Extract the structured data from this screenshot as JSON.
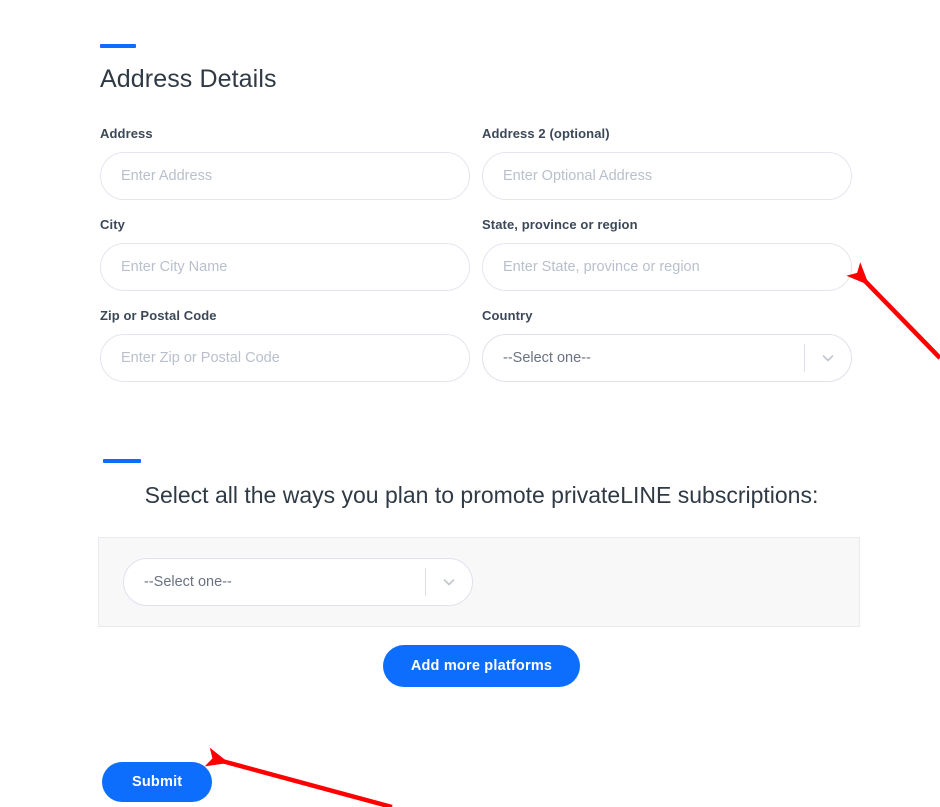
{
  "theme": {
    "accent": "#0d6efd",
    "label_color": "#3c4858",
    "heading_color": "#2f3a45",
    "placeholder_color": "#b9bfcc",
    "panel_bg": "#f8f8f9",
    "annotation_color": "#ff0000"
  },
  "address_section": {
    "title": "Address Details",
    "fields": [
      {
        "label": "Address",
        "placeholder": "Enter Address",
        "value": "",
        "type": "text"
      },
      {
        "label": "Address 2 (optional)",
        "placeholder": "Enter Optional Address",
        "value": "",
        "type": "text"
      },
      {
        "label": "City",
        "placeholder": "Enter City Name",
        "value": "",
        "type": "text"
      },
      {
        "label": "State, province or region",
        "placeholder": "Enter State, province or region",
        "value": "",
        "type": "text"
      },
      {
        "label": "Zip or Postal Code",
        "placeholder": "Enter Zip or Postal Code",
        "value": "",
        "type": "text"
      },
      {
        "label": "Country",
        "placeholder": "",
        "value": "--Select one--",
        "type": "select"
      }
    ]
  },
  "promote_section": {
    "title": "Select all the ways you plan to promote privateLINE subscriptions:",
    "platform_select": {
      "value": "--Select one--",
      "icon": "chevron-down-icon"
    },
    "add_more_label": "Add more platforms"
  },
  "footer": {
    "submit_label": "Submit"
  },
  "annotations": [
    {
      "name": "arrow-to-state-field",
      "icon": "arrow-icon",
      "points_to": "State, province or region"
    },
    {
      "name": "arrow-to-submit-button",
      "icon": "arrow-icon",
      "points_to": "Submit"
    }
  ]
}
